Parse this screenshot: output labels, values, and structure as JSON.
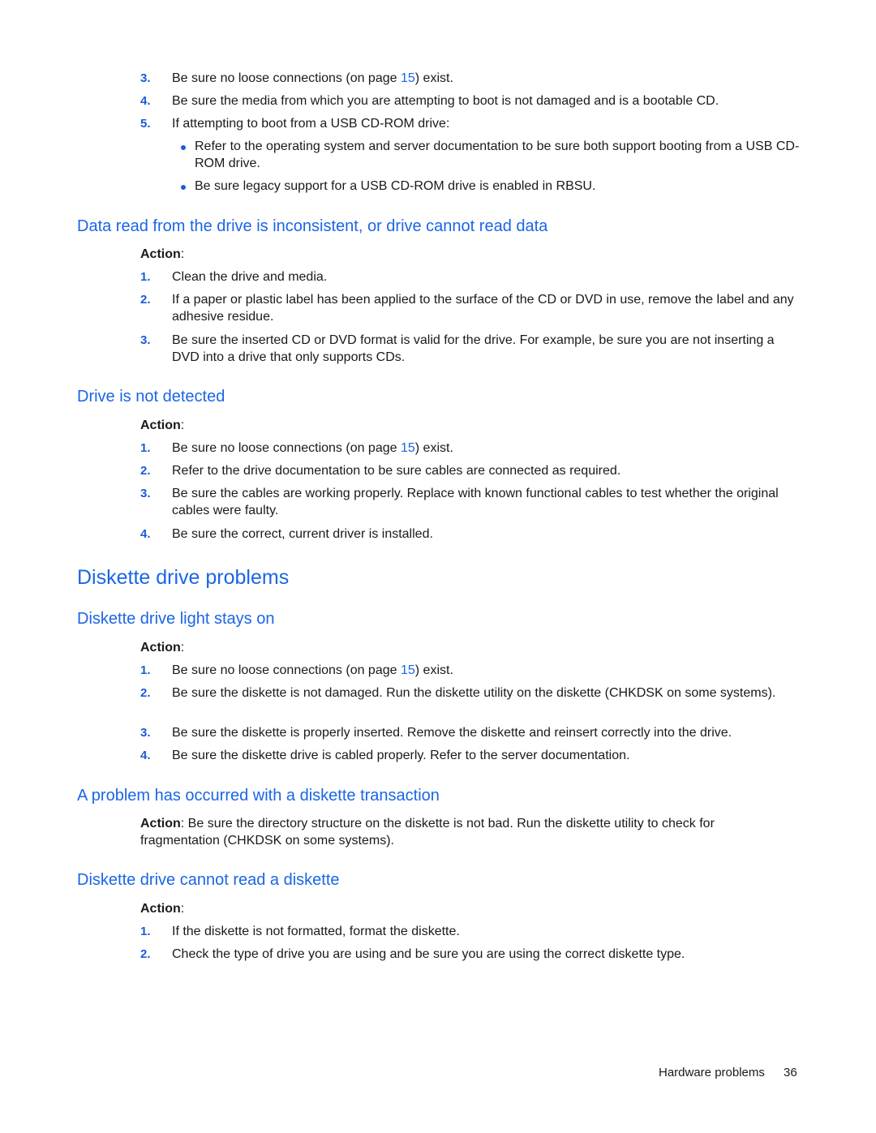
{
  "top_list": {
    "items": [
      {
        "num": "3.",
        "pre": "Be sure no loose connections (on page ",
        "link": "15",
        "post": ") exist."
      },
      {
        "num": "4.",
        "text": "Be sure the media from which you are attempting to boot is not damaged and is a bootable CD."
      },
      {
        "num": "5.",
        "text": "If attempting to boot from a USB CD-ROM drive:"
      }
    ],
    "bullets": [
      "Refer to the operating system and server documentation to be sure both support booting from a USB CD-ROM drive.",
      "Be sure legacy support for a USB CD-ROM drive is enabled in RBSU."
    ]
  },
  "section_inconsistent": {
    "heading": "Data read from the drive is inconsistent, or drive cannot read data",
    "action_label": "Action",
    "items": [
      {
        "num": "1.",
        "text": "Clean the drive and media."
      },
      {
        "num": "2.",
        "text": "If a paper or plastic label has been applied to the surface of the CD or DVD in use, remove the label and any adhesive residue."
      },
      {
        "num": "3.",
        "text": "Be sure the inserted CD or DVD format is valid for the drive. For example, be sure you are not inserting a DVD into a drive that only supports CDs."
      }
    ]
  },
  "section_not_detected": {
    "heading": "Drive is not detected",
    "action_label": "Action",
    "items": [
      {
        "num": "1.",
        "pre": "Be sure no loose connections (on page ",
        "link": "15",
        "post": ") exist."
      },
      {
        "num": "2.",
        "text": "Refer to the drive documentation to be sure cables are connected as required."
      },
      {
        "num": "3.",
        "text": "Be sure the cables are working properly. Replace with known functional cables to test whether the original cables were faulty."
      },
      {
        "num": "4.",
        "text": "Be sure the correct, current driver is installed."
      }
    ]
  },
  "diskette_title": "Diskette drive problems",
  "section_light": {
    "heading": "Diskette drive light stays on",
    "action_label": "Action",
    "items": [
      {
        "num": "1.",
        "pre": "Be sure no loose connections (on page ",
        "link": "15",
        "post": ") exist."
      },
      {
        "num": "2.",
        "text": "Be sure the diskette is not damaged. Run the diskette utility on the diskette (CHKDSK on some systems)."
      },
      {
        "num": "3.",
        "text": "Be sure the diskette is properly inserted. Remove the diskette and reinsert correctly into the drive."
      },
      {
        "num": "4.",
        "text": "Be sure the diskette drive is cabled properly. Refer to the server documentation."
      }
    ]
  },
  "section_transaction": {
    "heading": "A problem has occurred with a diskette transaction",
    "action_label": "Action",
    "text": ": Be sure the directory structure on the diskette is not bad. Run the diskette utility to check for fragmentation (CHKDSK on some systems)."
  },
  "section_cannot_read": {
    "heading": "Diskette drive cannot read a diskette",
    "action_label": "Action",
    "items": [
      {
        "num": "1.",
        "text": "If the diskette is not formatted, format the diskette."
      },
      {
        "num": "2.",
        "text": "Check the type of drive you are using and be sure you are using the correct diskette type."
      }
    ]
  },
  "footer": {
    "section": "Hardware problems",
    "page": "36"
  }
}
